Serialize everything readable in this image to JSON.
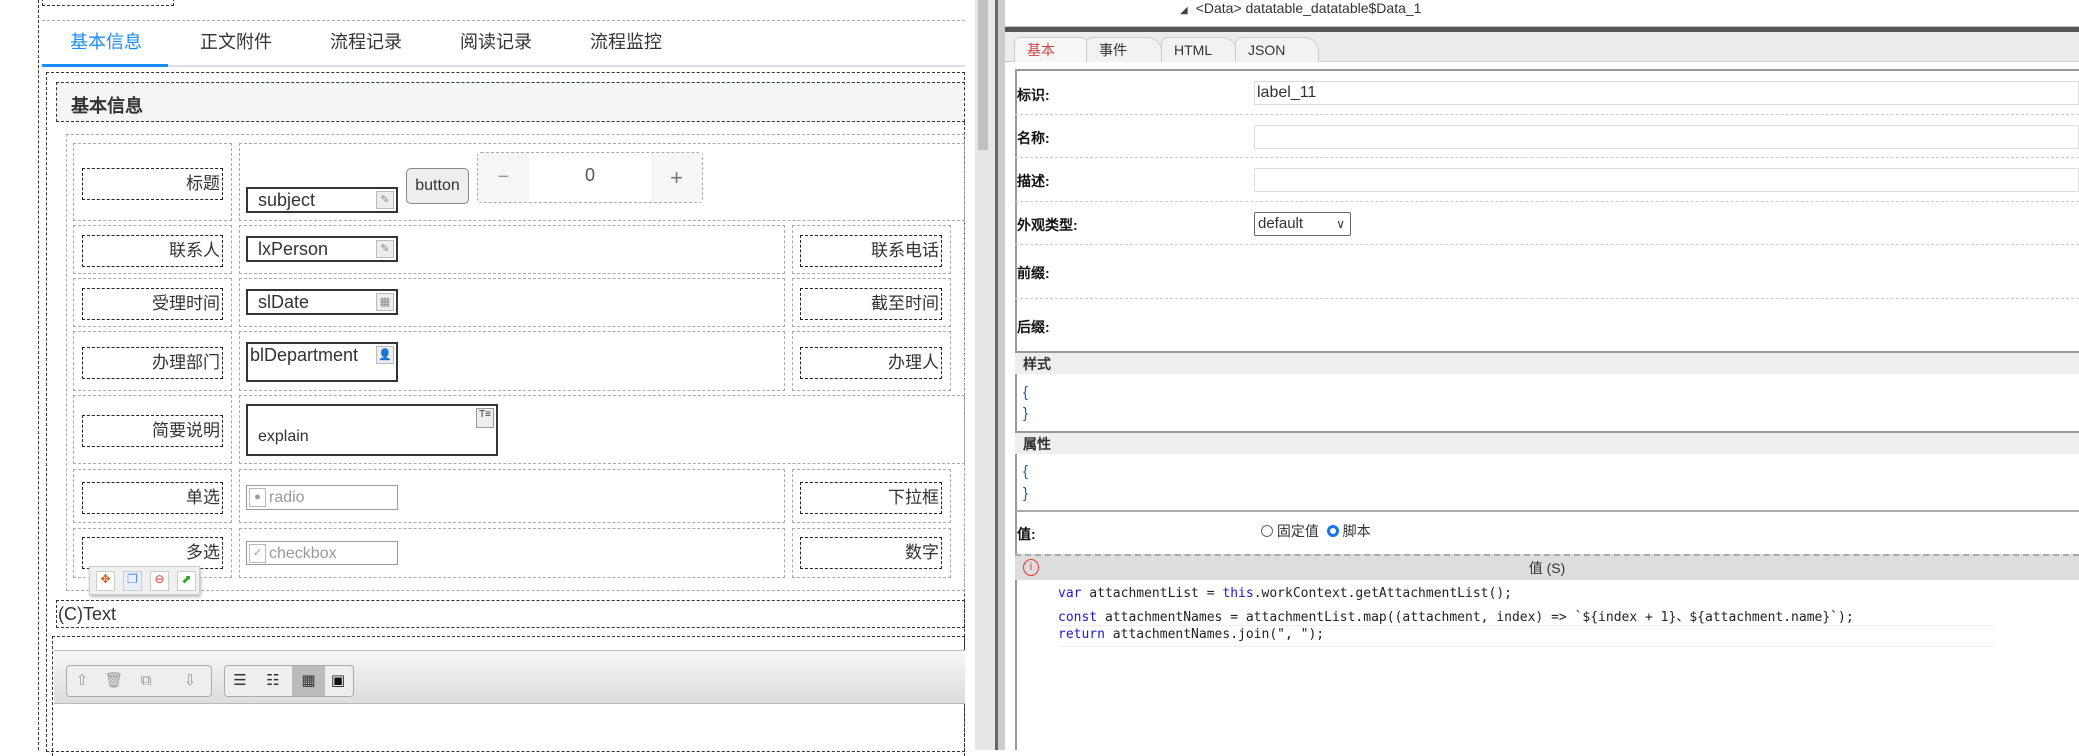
{
  "tabs": [
    "基本信息",
    "正文附件",
    "流程记录",
    "阅读记录",
    "流程监控"
  ],
  "section_title": "基本信息",
  "form": {
    "subject_label": "标题",
    "subject": "subject",
    "button": "button",
    "stepper": {
      "minus": "−",
      "value": "0",
      "plus": "+"
    },
    "lxperson_label": "联系人",
    "lxperson": "lxPerson",
    "phone_label": "联系电话",
    "sldate_label": "受理时间",
    "sldate": "slDate",
    "deadline_label": "截至时间",
    "dept_label": "办理部门",
    "dept": "blDepartment",
    "handler_label": "办理人",
    "explain_label": "简要说明",
    "explain": "explain",
    "radio_label": "单选",
    "radio": "radio",
    "dropdown_label": "下拉框",
    "checkbox_label": "多选",
    "checkbox": "checkbox",
    "number_label": "数字"
  },
  "text_component": "(C)Text",
  "tree_line": "<Data> datatable_datatable$Data_1",
  "prop_tabs": [
    "基本",
    "事件",
    "HTML",
    "JSON"
  ],
  "props": {
    "id_label": "标识:",
    "id_value": "label_11",
    "name_label": "名称:",
    "desc_label": "描述:",
    "appearance_label": "外观类型:",
    "appearance_value": "default",
    "prefix_label": "前缀:",
    "suffix_label": "后缀:",
    "style_header": "样式",
    "attr_header": "属性",
    "open_brace": "{",
    "close_brace": "}",
    "value_label": "值:",
    "opt_fixed": "固定值",
    "opt_script": "脚本",
    "script_header": "值 (S)"
  },
  "code": {
    "l1_kw": "var",
    "l1": " attachmentList = ",
    "l1_kw2": "this",
    "l1b": ".workContext.getAttachmentList();",
    "l2_kw": "const",
    "l2": " attachmentNames = attachmentList.map((attachment, index) => `${index + 1}、${attachment.name}`);",
    "l3_kw": "return",
    "l3": " attachmentNames.join(\", \");"
  }
}
